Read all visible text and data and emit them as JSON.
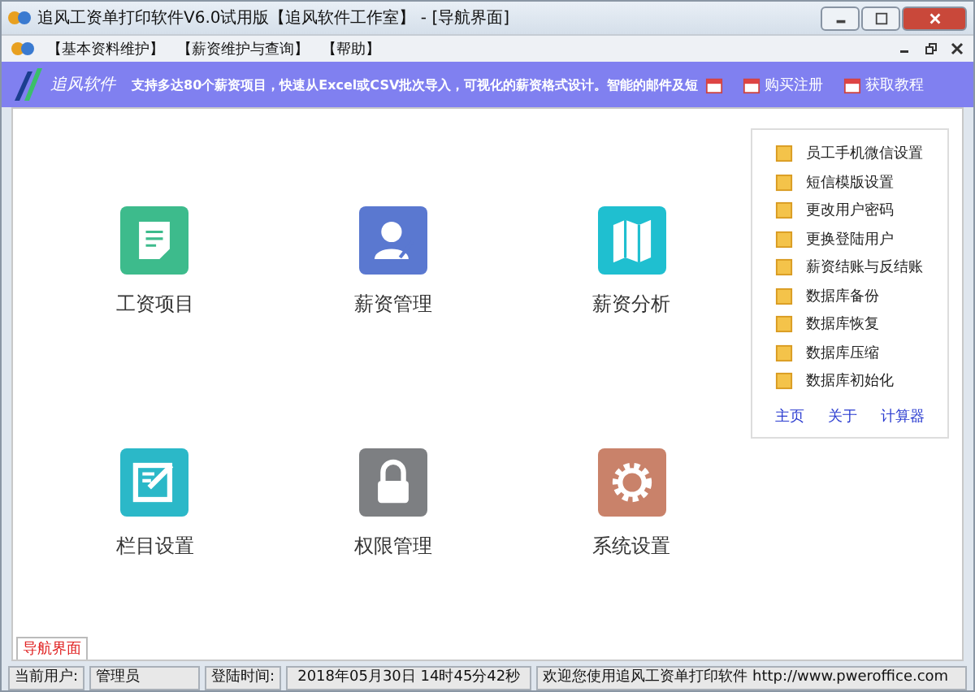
{
  "window": {
    "title": "追风工资单打印软件V6.0试用版【追风软件工作室】 - [导航界面]"
  },
  "menu": [
    "【基本资料维护】",
    "【薪资维护与查询】",
    "【帮助】"
  ],
  "banner": {
    "brand": "追风软件",
    "ticker": "支持多达80个薪资项目，快速从Excel或CSV批次导入，可视化的薪资格式设计。智能的邮件及短",
    "links": [
      "购买注册",
      "获取教程"
    ]
  },
  "tiles": [
    {
      "label": "工资项目",
      "kind": "doc",
      "color": "#3dbb8c"
    },
    {
      "label": "薪资管理",
      "kind": "user",
      "color": "#5a78d0"
    },
    {
      "label": "薪资分析",
      "kind": "map",
      "color": "#1fbfd0"
    },
    {
      "label": "栏目设置",
      "kind": "edit",
      "color": "#2bb8c8"
    },
    {
      "label": "权限管理",
      "kind": "lock",
      "color": "#7d7f82"
    },
    {
      "label": "系统设置",
      "kind": "gear",
      "color": "#c9826a"
    }
  ],
  "side_panel": {
    "items": [
      "员工手机微信设置",
      "短信模版设置",
      "更改用户密码",
      "更换登陆用户",
      "薪资结账与反结账",
      "数据库备份",
      "数据库恢复",
      "数据库压缩",
      "数据库初始化"
    ],
    "links": [
      "主页",
      "关于",
      "计算器"
    ]
  },
  "tabs": [
    {
      "label": "导航界面",
      "selected": true
    }
  ],
  "status_bar": {
    "user_label": "当前用户:",
    "user": "管理员",
    "login_label": "登陆时间:",
    "login_time": "2018年05月30日 14时45分42秒",
    "message": "欢迎您使用追风工资单打印软件 http://www.pweroffice.com"
  }
}
